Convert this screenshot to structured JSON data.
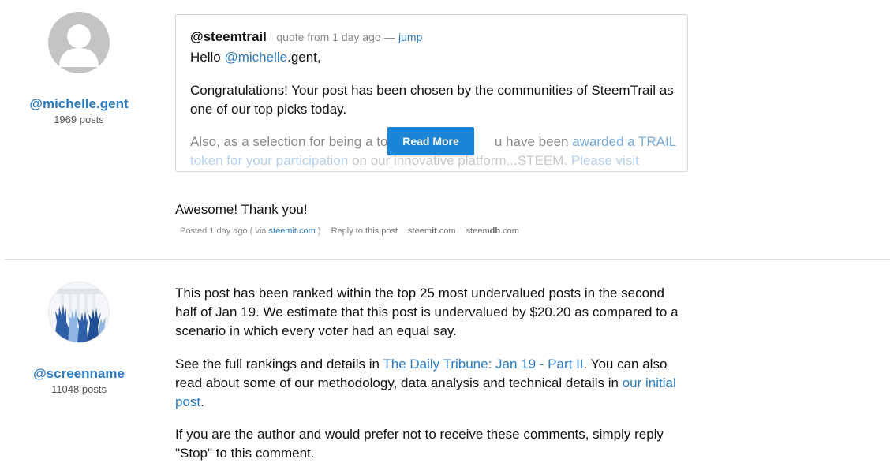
{
  "post1": {
    "author": {
      "name": "@michelle.gent",
      "posts": "1969 posts",
      "avatar_icon": "default-user-icon"
    },
    "quote": {
      "user": "@steemtrail",
      "meta": "quote from 1 day ago —",
      "jump": "jump",
      "greeting_prefix": "Hello ",
      "greeting_mention": "@michelle",
      "greeting_suffix": ".gent,",
      "line1": "Congratulations! Your post has been chosen by the communities of SteemTrail as",
      "line2": "one of our top picks today.",
      "line3_before": "Also, as a selection for being a top",
      "line3_hidden": "",
      "line3_after": "u have been ",
      "line3_link": "awarded a TRAIL",
      "line4_link1": "token for your participation",
      "line4_mid": " on our innovative platform...STEEM. ",
      "line4_link2": "Please visit",
      "read_more": "Read More"
    },
    "comment": {
      "text": "Awesome! Thank you!",
      "posted": "Posted 1 day ago ( via ",
      "via": "steemit.com",
      "posted_end": " )",
      "reply": "Reply to this post",
      "link1_a": "steem",
      "link1_b": "it",
      "link1_c": ".com",
      "link2_a": "steem",
      "link2_b": "db",
      "link2_c": ".com"
    }
  },
  "post2": {
    "author": {
      "name": "@screenname",
      "posts": "11048 posts",
      "avatar_icon": "raised-hands-icon"
    },
    "p1_l1": "This post has been ranked within the top 25 most undervalued posts in the second",
    "p1_l2": "half of Jan 19. We estimate that this post is undervalued by $20.20 as compared to a",
    "p1_l3": "scenario in which every voter had an equal say.",
    "p2_l1_a": "See the full rankings and details in ",
    "p2_l1_link": "The Daily Tribune: Jan 19 - Part II",
    "p2_l1_b": ". You can also",
    "p2_l2_a": "read about some of our methodology, data analysis and technical details in ",
    "p2_l2_link": "our initial",
    "p2_l3_link": "post",
    "p2_l3_b": ".",
    "p3_l1": "If you are the author and would prefer not to receive these comments, simply reply",
    "p3_l2": "\"Stop\" to this comment."
  }
}
